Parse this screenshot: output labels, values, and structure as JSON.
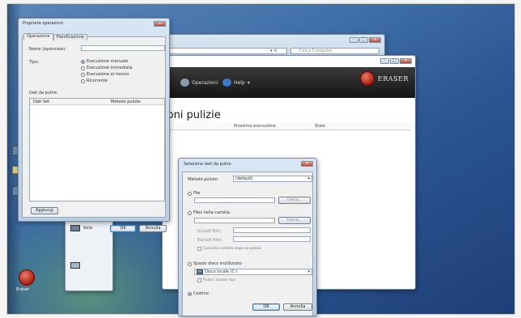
{
  "colors": {
    "desktop": "#2c5692",
    "eraser_toolbar": "#151515",
    "eraser_logo": "#a8200f",
    "dialog_face": "#f0f0f0",
    "close_button": "#c6432e"
  },
  "explorer": {
    "search_placeholder": "Cerca Computer"
  },
  "eraser": {
    "toolbar": {
      "schedule_label": "Operazioni",
      "help_label": "Help"
    },
    "logo_text": "ERASER",
    "heading": "ioni pulizie",
    "list_headers": {
      "next_run": "Prossima esecuzione",
      "status": "Stato"
    }
  },
  "desktop": {
    "recycle_label": "Eraser",
    "panel_item": "Rete"
  },
  "task_dialog": {
    "title": "Proprietà operazioni",
    "tabs": [
      "Operazione",
      "Pianificazione"
    ],
    "name_label": "Nome (opzionale):",
    "type_label": "Tipo:",
    "type_options": [
      {
        "label": "Esecuzione manuale",
        "selected": true
      },
      {
        "label": "Esecuzione immediata",
        "selected": false
      },
      {
        "label": "Esecuzione al riavvio",
        "selected": false
      },
      {
        "label": "Ricorrente",
        "selected": false
      }
    ],
    "data_label": "Dati da pulire:",
    "columns": [
      "Dati Set",
      "Metodo pulizie"
    ],
    "add_button": "Aggiungi",
    "ok_button": "OK",
    "cancel_button": "Annulla"
  },
  "target_dialog": {
    "title": "Selezione dati da pulire",
    "method_label": "Metodo pulizie:",
    "method_value": "(default)",
    "file_option": "File",
    "browse_label": "Cerca...",
    "folder_option": "Files nella cartella",
    "browse_folder_label": "Cerca...",
    "include_label": "Includi filtri:",
    "exclude_label": "Escludi filtri:",
    "delete_folder_check": "Cancella cartella dopo la pulizia",
    "unused_option": "Spazio disco inutilizzato",
    "drive_value": "Disco locale (C:)",
    "cluster_check": "Pulisci cluster tips",
    "recycle_option": "Cestino",
    "recycle_selected": true,
    "ok_button": "OK",
    "cancel_button": "Annulla"
  }
}
